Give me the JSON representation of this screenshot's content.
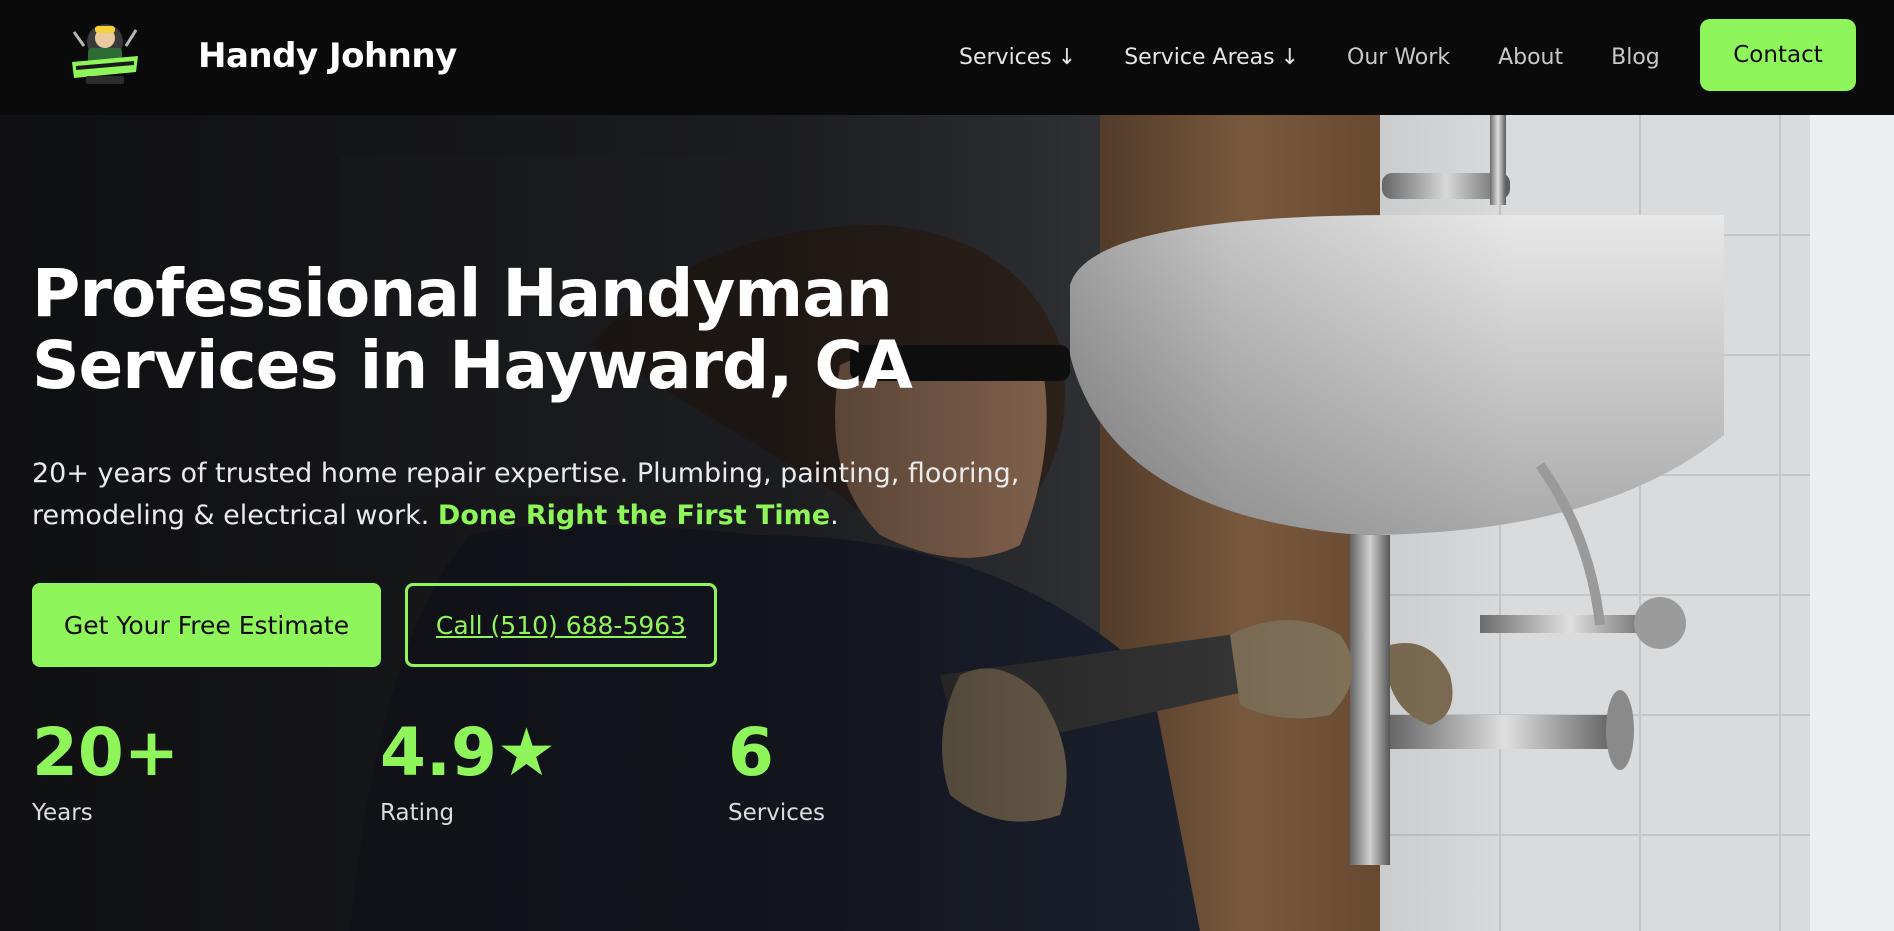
{
  "brand": {
    "name": "Handy Johnny",
    "logo_alt": "handy-johnny-logo"
  },
  "nav": {
    "items": [
      {
        "label": "Services",
        "has_dropdown": true
      },
      {
        "label": "Service Areas",
        "has_dropdown": true
      },
      {
        "label": "Our Work",
        "has_dropdown": false
      },
      {
        "label": "About",
        "has_dropdown": false
      },
      {
        "label": "Blog",
        "has_dropdown": false
      }
    ],
    "dropdown_icon": "arrow-down",
    "contact_label": "Contact"
  },
  "hero": {
    "headline_line1": "Professional Handyman",
    "headline_line2": "Services in Hayward, CA",
    "subtext": "20+ years of trusted home repair expertise. Plumbing, painting, flooring, remodeling & electrical work.",
    "subtext_accent": "Done Right the First Time",
    "subtext_end": ".",
    "primary_cta": "Get Your Free Estimate",
    "secondary_cta": "Call (510) 688-5963",
    "stats": [
      {
        "value": "20+",
        "label": "Years"
      },
      {
        "value": "4.9★",
        "label": "Rating"
      },
      {
        "value": "6",
        "label": "Services"
      }
    ]
  },
  "colors": {
    "accent": "#8ef55a",
    "nav_bg": "#0a0a0a",
    "text": "#ffffff"
  }
}
